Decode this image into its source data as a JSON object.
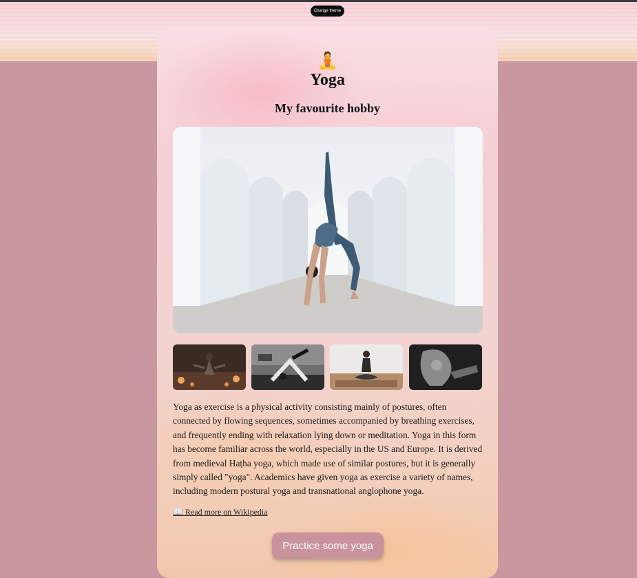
{
  "header": {
    "theme_button_label": "Change theme"
  },
  "card": {
    "emoji": "🧘",
    "title": "Yoga",
    "subtitle": "My favourite hobby",
    "description": "Yoga as exercise is a physical activity consisting mainly of postures, often connected by flowing sequences, sometimes accompanied by breathing exercises, and frequently ending with relaxation lying down or meditation. Yoga in this form has become familiar across the world, especially in the US and Europe. It is derived from medieval Haṭha yoga, which made use of similar postures, but it is generally simply called \"yoga\". Academics have given yoga as exercise a variety of names, including modern postural yoga and transnational anglophone yoga.",
    "wiki_link_icon": "📖",
    "wiki_link_label": "Read more on Wikipedia",
    "cta_label": "Practice some yoga"
  },
  "colors": {
    "page_background": "#c9979f",
    "cta_background": "#c9929c",
    "theme_button_background": "#0d0d0d"
  }
}
